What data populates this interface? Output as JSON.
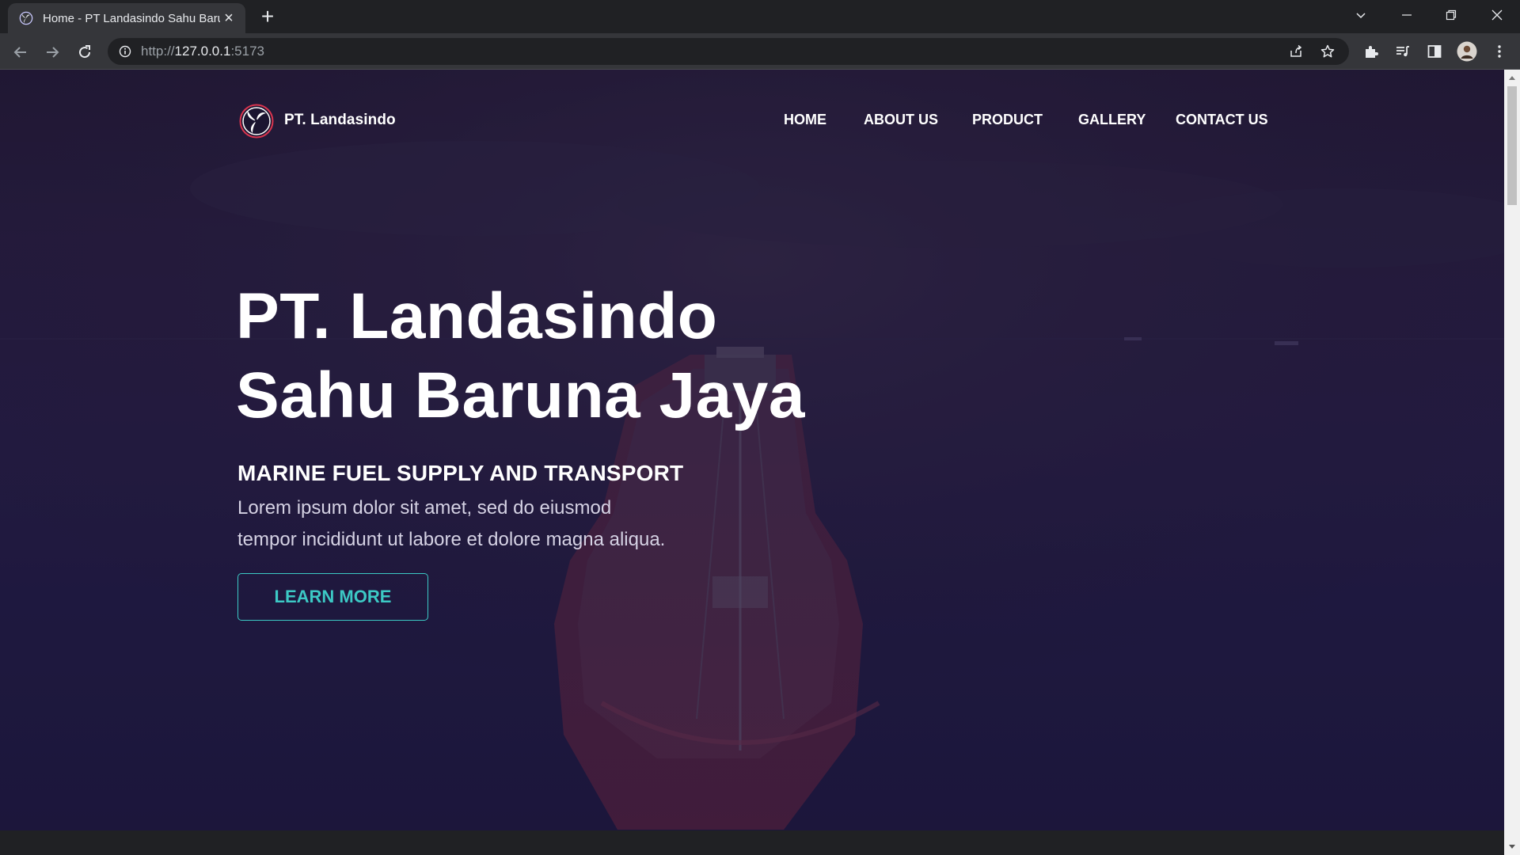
{
  "browser": {
    "tab_title": "Home - PT Landasindo Sahu Baruna Jaya",
    "url_scheme": "http://",
    "url_host": "127.0.0.1",
    "url_port": ":5173"
  },
  "site": {
    "brand": "PT. Landasindo",
    "nav": [
      "HOME",
      "ABOUT US",
      "PRODUCT",
      "GALLERY",
      "CONTACT US"
    ]
  },
  "hero": {
    "title_line1": "PT. Landasindo",
    "title_line2": "Sahu Baruna Jaya",
    "subtitle": "MARINE FUEL SUPPLY AND TRANSPORT",
    "text_line1": "Lorem ipsum dolor sit amet, sed do eiusmod",
    "text_line2": "tempor incididunt ut labore et dolore magna aliqua.",
    "button": "LEARN MORE"
  },
  "colors": {
    "accent": "#3cc9c5",
    "hero_bg": "#231d45",
    "chrome_dark": "#202124",
    "chrome_toolbar": "#35363a"
  }
}
